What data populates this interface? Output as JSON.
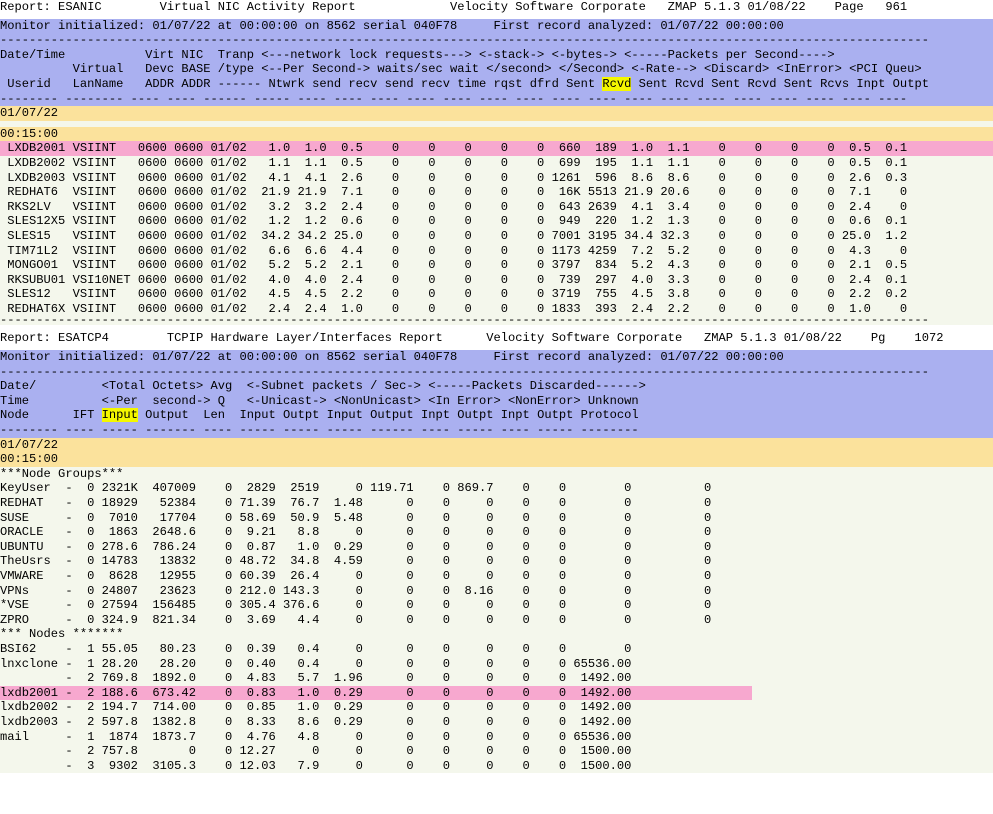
{
  "report1": {
    "title_line": "Report: ESANIC        Virtual NIC Activity Report             Velocity Software Corporate   ZMAP 5.1.3 01/08/22    Page   961",
    "monitor_line": "Monitor initialized: 01/07/22 at 00:00:00 on 8562 serial 040F78     First record analyzed: 01/07/22 00:00:00",
    "dashes": "--------------------------------------------------------------------------------------------------------------------------------",
    "header1": "Date/Time           Virt NIC  Tranp <---network lock requests---> <-stack-> <-bytes-> <-----Packets per Second---->",
    "header2": "          Virtual   Devc BASE /type <--Per Second-> waits/sec wait </second> </Second> <-Rate--> <Discard> <InError> <PCI Queu>",
    "header3": [
      " Userid   LanName   ADDR ADDR ------ Ntwrk send recv send recv time rqst dfrd Sent ",
      "Rcvd",
      " Sent Rcvd Sent Rcvd Sent Rcvs Inpt Outpt"
    ],
    "header4": "-------- -------- ---- ---- ------ ----- ---- ---- ---- ---- ---- ---- ---- ---- ---- ---- ---- ---- ---- ---- ---- ---- ----",
    "date": "01/07/22",
    "time": "00:15:00",
    "rows": [
      " LXDB2001 VSIINT   0600 0600 01/02   1.0  1.0  0.5    0    0    0    0    0  660  189  1.0  1.1    0    0    0    0  0.5  0.1",
      " LXDB2002 VSIINT   0600 0600 01/02   1.1  1.1  0.5    0    0    0    0    0  699  195  1.1  1.1    0    0    0    0  0.5  0.1",
      " LXDB2003 VSIINT   0600 0600 01/02   4.1  4.1  2.6    0    0    0    0    0 1261  596  8.6  8.6    0    0    0    0  2.6  0.3",
      " REDHAT6  VSIINT   0600 0600 01/02  21.9 21.9  7.1    0    0    0    0    0  16K 5513 21.9 20.6    0    0    0    0  7.1    0",
      " RKS2LV   VSIINT   0600 0600 01/02   3.2  3.2  2.4    0    0    0    0    0  643 2639  4.1  3.4    0    0    0    0  2.4    0",
      " SLES12X5 VSIINT   0600 0600 01/02   1.2  1.2  0.6    0    0    0    0    0  949  220  1.2  1.3    0    0    0    0  0.6  0.1",
      " SLES15   VSIINT   0600 0600 01/02  34.2 34.2 25.0    0    0    0    0    0 7001 3195 34.4 32.3    0    0    0    0 25.0  1.2",
      " TIM71L2  VSIINT   0600 0600 01/02   6.6  6.6  4.4    0    0    0    0    0 1173 4259  7.2  5.2    0    0    0    0  4.3    0",
      " MONGO01  VSIINT   0600 0600 01/02   5.2  5.2  2.1    0    0    0    0    0 3797  834  5.2  4.3    0    0    0    0  2.1  0.5",
      " RKSUBU01 VSI10NET 0600 0600 01/02   4.0  4.0  2.4    0    0    0    0    0  739  297  4.0  3.3    0    0    0    0  2.4  0.1",
      " SLES12   VSIINT   0600 0600 01/02   4.5  4.5  2.2    0    0    0    0    0 3719  755  4.5  3.8    0    0    0    0  2.2  0.2",
      " REDHAT6X VSIINT   0600 0600 01/02   2.4  2.4  1.0    0    0    0    0    0 1833  393  2.4  2.2    0    0    0    0  1.0    0"
    ],
    "highlight_row": 0,
    "dash_end": "--------------------------------------------------------------------------------------------------------------------------------"
  },
  "report2": {
    "title_line": "Report: ESATCP4        TCPIP Hardware Layer/Interfaces Report      Velocity Software Corporate   ZMAP 5.1.3 01/08/22    Pg    1072",
    "monitor_line": "Monitor initialized: 01/07/22 at 00:00:00 on 8562 serial 040F78     First record analyzed: 01/07/22 00:00:00",
    "dashes": "--------------------------------------------------------------------------------------------------------------------------------",
    "header1": "Date/         <Total Octets> Avg  <-Subnet packets / Sec-> <-----Packets Discarded------>",
    "header2": "Time          <-Per  second-> Q   <-Unicast-> <NonUnicast> <In Error> <NonError> Unknown",
    "header3": [
      "Node      IFT ",
      "Input",
      " Output  Len  Input Outpt Input Output Inpt Outpt Inpt Outpt Protocol"
    ],
    "header4": "-------- ---- ----- ------- ---- ----- ----- ----- ------ ---- ----- ---- ----- --------",
    "date": "01/07/22",
    "time": "00:15:00",
    "section_groups": "***Node Groups***",
    "groups": [
      "KeyUser  -  0 2321K  407009    0  2829  2519     0 119.71    0 869.7    0    0        0          0",
      "REDHAT   -  0 18929   52384    0 71.39  76.7  1.48      0    0     0    0    0        0          0",
      "SUSE     -  0  7010   17704    0 58.69  50.9  5.48      0    0     0    0    0        0          0",
      "ORACLE   -  0  1863  2648.6    0  9.21   8.8     0      0    0     0    0    0        0          0",
      "UBUNTU   -  0 278.6  786.24    0  0.87   1.0  0.29      0    0     0    0    0        0          0",
      "TheUsrs  -  0 14783   13832    0 48.72  34.8  4.59      0    0     0    0    0        0          0",
      "VMWARE   -  0  8628   12955    0 60.39  26.4     0      0    0     0    0    0        0          0",
      "VPNs     -  0 24807   23623    0 212.0 143.3     0      0    0  8.16    0    0        0          0",
      "*VSE     -  0 27594  156485    0 305.4 376.6     0      0    0     0    0    0        0          0",
      "ZPRO     -  0 324.9  821.34    0  3.69   4.4     0      0    0     0    0    0        0          0"
    ],
    "section_nodes": "*** Nodes *******",
    "nodes": [
      "BSI62    -  1 55.05   80.23    0  0.39   0.4     0      0    0     0    0    0        0",
      "lnxclone -  1 28.20   28.20    0  0.40   0.4     0      0    0     0    0    0 65536.00",
      "         -  2 769.8  1892.0    0  4.83   5.7  1.96      0    0     0    0    0  1492.00",
      "lxdb2001 -  2 188.6  673.42    0  0.83   1.0  0.29      0    0     0    0    0  1492.00",
      "lxdb2002 -  2 194.7  714.00    0  0.85   1.0  0.29      0    0     0    0    0  1492.00",
      "lxdb2003 -  2 597.8  1382.8    0  8.33   8.6  0.29      0    0     0    0    0  1492.00",
      "mail     -  1  1874  1873.7    0  4.76   4.8     0      0    0     0    0    0 65536.00",
      "         -  2 757.8       0    0 12.27     0     0      0    0     0    0    0  1500.00",
      "         -  3  9302  3105.3    0 12.03   7.9     0      0    0     0    0    0  1500.00"
    ],
    "highlight_node": 3
  },
  "colors": {
    "header_blue": "#aab0f0",
    "date_band": "#fbe29c",
    "row_bg": "#f4f7ec",
    "highlight_pink": "#f7a8cf",
    "column_highlight": "#f4f700"
  }
}
